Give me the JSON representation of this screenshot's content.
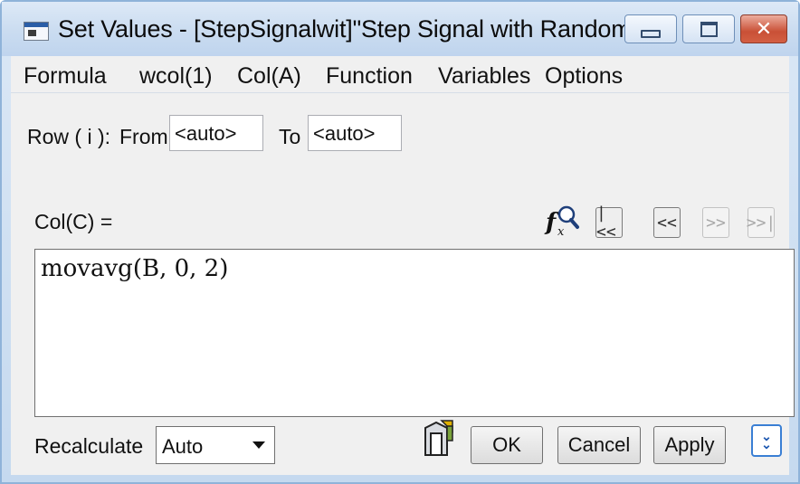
{
  "window": {
    "title": "Set Values - [StepSignalwit]\"Step Signal with Random N...",
    "controls": {
      "minimize": "minimize-icon",
      "maximize": "maximize-icon",
      "close": "close-icon"
    }
  },
  "menu": {
    "items": [
      "Formula",
      "wcol(1)",
      "Col(A)",
      "Function",
      "Variables",
      "Options"
    ]
  },
  "row_range": {
    "label": "Row ( i ):",
    "from_label": "From",
    "from_value": "<auto>",
    "to_label": "To",
    "to_value": "<auto>"
  },
  "formula": {
    "column_label": "Col(C) =",
    "text": "movavg(B, 0, 2)",
    "nav": {
      "first": "|<<",
      "prev": "<<",
      "next": ">>",
      "last": ">>|"
    }
  },
  "footer": {
    "recalculate_label": "Recalculate",
    "recalculate_value": "Auto",
    "ok_label": "OK",
    "cancel_label": "Cancel",
    "apply_label": "Apply"
  },
  "colors": {
    "title_gradient": "#cadcf0",
    "client_bg": "#f0f0f0",
    "close_button": "#c95036",
    "expand_accent": "#3a7fd4"
  }
}
